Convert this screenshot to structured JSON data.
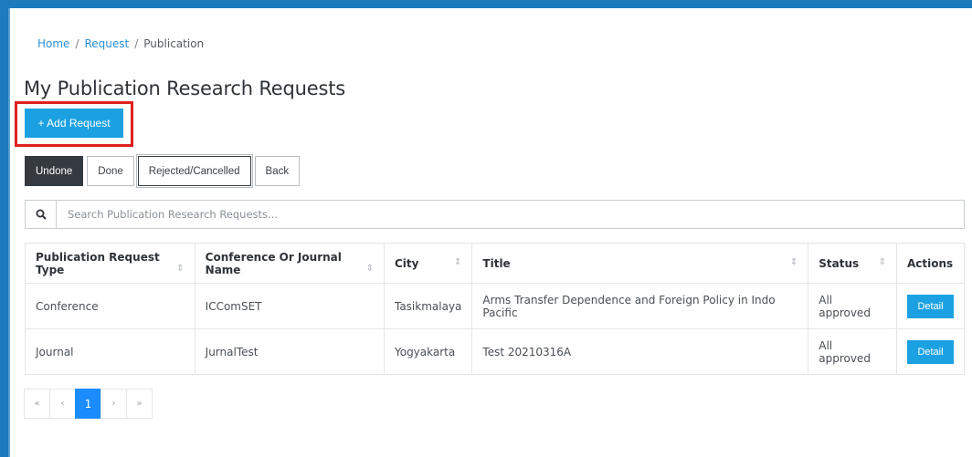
{
  "breadcrumb": {
    "home": "Home",
    "request": "Request",
    "current": "Publication",
    "separator": "/"
  },
  "page_title": "My Publication Research Requests",
  "add_button": {
    "label": "+ Add Request"
  },
  "filters": [
    "Undone",
    "Done",
    "Rejected/Cancelled",
    "Back"
  ],
  "search": {
    "placeholder": "Search Publication Research Requests...",
    "value": ""
  },
  "table": {
    "headers": [
      "Publication Request Type",
      "Conference Or Journal Name",
      "City",
      "Title",
      "Status",
      "Actions"
    ],
    "rows": [
      {
        "type": "Conference",
        "name": "ICComSET",
        "city": "Tasikmalaya",
        "title": "Arms Transfer Dependence and Foreign Policy in Indo Pacific",
        "status": "All approved",
        "action": "Detail"
      },
      {
        "type": "Journal",
        "name": "JurnalTest",
        "city": "Yogyakarta",
        "title": "Test 20210316A",
        "status": "All approved",
        "action": "Detail"
      }
    ]
  },
  "pagination": {
    "first": "«",
    "prev": "‹",
    "current": "1",
    "next": "›",
    "last": "»"
  },
  "colors": {
    "accent": "#1ba1e2",
    "frame": "#1b7bbd",
    "highlight": "#e02020",
    "active_filter": "#343a40",
    "active_page": "#1a8cff"
  },
  "icons": {
    "search": "search-icon",
    "sort": "sort-icon"
  }
}
